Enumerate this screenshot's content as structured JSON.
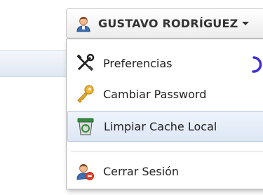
{
  "user_menu": {
    "user_name": "GUSTAVO RODRÍGUEZ",
    "user_icon": "user-icon",
    "caret_icon": "caret-down-icon"
  },
  "menu": {
    "items": [
      {
        "label": "Preferencias",
        "icon": "tools-icon"
      },
      {
        "label": "Cambiar Password",
        "icon": "key-icon"
      },
      {
        "label": "Limpiar Cache Local",
        "icon": "recycle-bin-icon",
        "selected": true
      },
      {
        "label": "Cerrar Sesión",
        "icon": "logout-user-icon"
      }
    ],
    "loading_indicator": "spinner-icon"
  },
  "colors": {
    "accent": "#3b2fd6",
    "menu_border": "#b9b9b9",
    "selected_bg": "#e6edf8"
  }
}
